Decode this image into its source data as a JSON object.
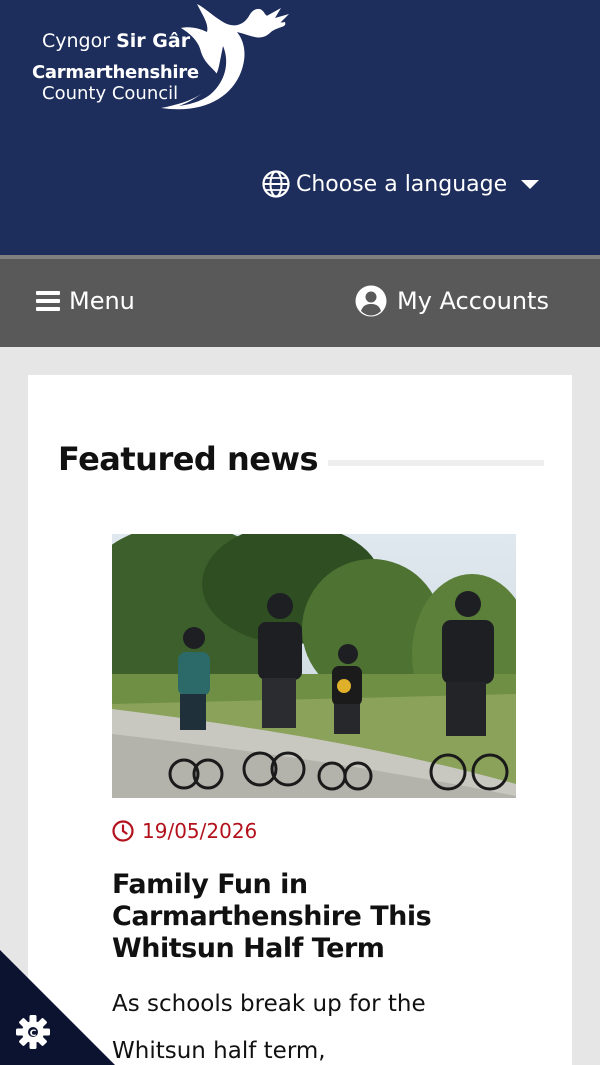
{
  "header": {
    "logo": {
      "line1_regular": "Cyngor",
      "line1_bold": "Sir Gâr",
      "line2": "Carmarthenshire",
      "line3": "County Council"
    },
    "language_label": "Choose a language",
    "background_color": "#1d2d5c",
    "icons": {
      "language": "globe-icon",
      "dropdown": "caret-down-icon",
      "logo": "dragon-icon"
    }
  },
  "navbar": {
    "menu_label": "Menu",
    "accounts_label": "My Accounts",
    "background_color": "#595959",
    "icons": {
      "menu": "hamburger-icon",
      "accounts": "user-circle-icon"
    }
  },
  "featured": {
    "section_title": "Featured news",
    "items": [
      {
        "date": "19/05/2026",
        "title": "Family Fun in Carmarthenshire This Whitsun Half Term",
        "summary": "As schools break up for the Whitsun half term,",
        "image": "family-cycling-photo"
      }
    ],
    "date_color": "#b3121d"
  },
  "cookie_settings": {
    "icon": "gear-icon",
    "background_color": "#0b1330"
  }
}
